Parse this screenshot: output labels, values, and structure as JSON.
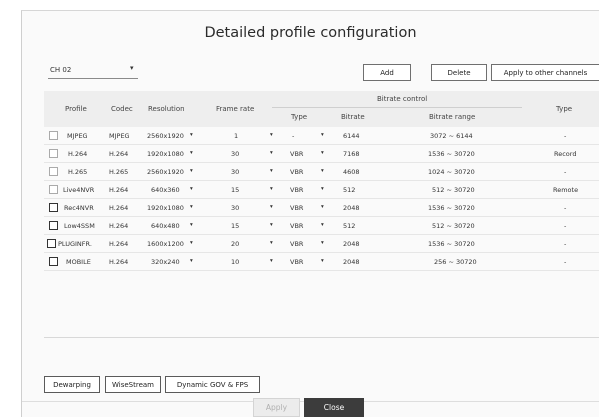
{
  "title": "Detailed profile configuration",
  "channel": {
    "value": "CH 02",
    "arrow": "▾"
  },
  "toolbar": {
    "add": "Add",
    "delete": "Delete",
    "apply_other": "Apply to other channels"
  },
  "headers": {
    "profile": "Profile",
    "codec": "Codec",
    "resolution": "Resolution",
    "frame_rate": "Frame rate",
    "bitrate_control": "Bitrate control",
    "bc_type": "Type",
    "bitrate": "Bitrate",
    "bitrate_range": "Bitrate range",
    "type": "Type"
  },
  "rows": [
    {
      "profile": "MJPEG",
      "codec": "MJPEG",
      "resolution": "2560x1920",
      "frame_rate": "1",
      "bc_type": "-",
      "bitrate": "6144",
      "range": "3072 ~ 6144",
      "type": "-"
    },
    {
      "profile": "H.264",
      "codec": "H.264",
      "resolution": "1920x1080",
      "frame_rate": "30",
      "bc_type": "VBR",
      "bitrate": "7168",
      "range": "1536 ~ 30720",
      "type": "Record"
    },
    {
      "profile": "H.265",
      "codec": "H.265",
      "resolution": "2560x1920",
      "frame_rate": "30",
      "bc_type": "VBR",
      "bitrate": "4608",
      "range": "1024 ~ 30720",
      "type": "-"
    },
    {
      "profile": "Live4NVR",
      "codec": "H.264",
      "resolution": "640x360",
      "frame_rate": "15",
      "bc_type": "VBR",
      "bitrate": "512",
      "range": "512 ~ 30720",
      "type": "Remote"
    },
    {
      "profile": "Rec4NVR",
      "codec": "H.264",
      "resolution": "1920x1080",
      "frame_rate": "30",
      "bc_type": "VBR",
      "bitrate": "2048",
      "range": "1536 ~ 30720",
      "type": "-"
    },
    {
      "profile": "Low4SSM",
      "codec": "H.264",
      "resolution": "640x480",
      "frame_rate": "15",
      "bc_type": "VBR",
      "bitrate": "512",
      "range": "512 ~ 30720",
      "type": "-"
    },
    {
      "profile": "PLUGINFR.",
      "codec": "H.264",
      "resolution": "1600x1200",
      "frame_rate": "20",
      "bc_type": "VBR",
      "bitrate": "2048",
      "range": "1536 ~ 30720",
      "type": "-"
    },
    {
      "profile": "MOBILE",
      "codec": "H.264",
      "resolution": "320x240",
      "frame_rate": "10",
      "bc_type": "VBR",
      "bitrate": "2048",
      "range": "256 ~ 30720",
      "type": "-"
    }
  ],
  "bottom_buttons": {
    "dewarping": "Dewarping",
    "wisestream": "WiseStream",
    "dynamic": "Dynamic GOV & FPS"
  },
  "footer": {
    "apply": "Apply",
    "close": "Close"
  }
}
